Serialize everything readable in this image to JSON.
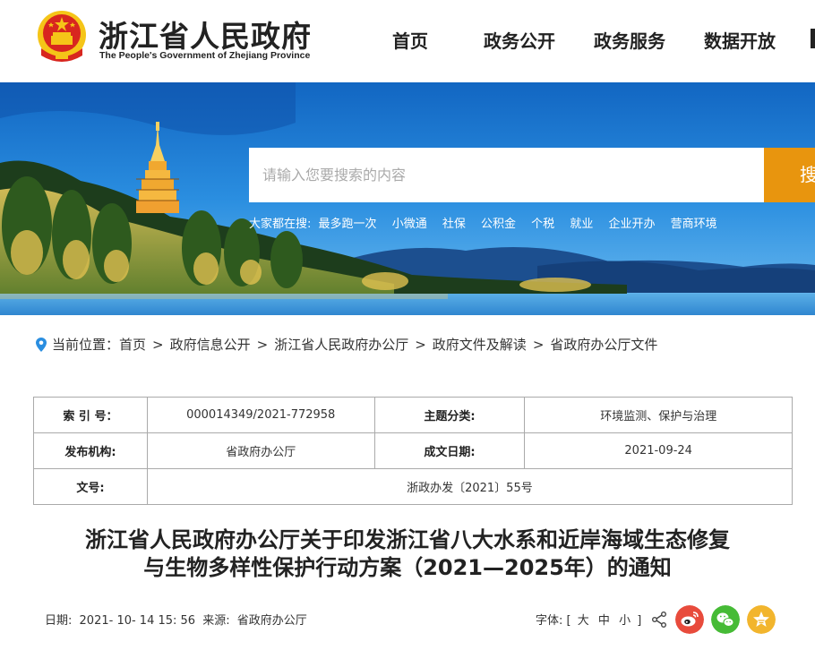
{
  "header": {
    "title": "浙江省人民政府",
    "subtitle": "The People's Government of Zhejiang Province",
    "nav": [
      "首页",
      "政务公开",
      "政务服务",
      "数据开放"
    ]
  },
  "search": {
    "placeholder": "请输入您要搜索的内容",
    "button_label": "搜索",
    "hot_label": "大家都在搜:",
    "hot_terms": [
      "最多跑一次",
      "小微通",
      "社保",
      "公积金",
      "个税",
      "就业",
      "企业开办",
      "营商环境"
    ]
  },
  "breadcrumb": {
    "label": "当前位置：",
    "items": [
      "首页",
      "政府信息公开",
      "浙江省人民政府办公厅",
      "政府文件及解读",
      "省政府办公厅文件"
    ],
    "separator": ">"
  },
  "info": {
    "index_label": "索 引 号：",
    "index_value": "000014349/2021-772958",
    "topic_label": "主题分类:",
    "topic_value": "环境监测、保护与治理",
    "issuer_label": "发布机构:",
    "issuer_value": "省政府办公厅",
    "date_label": "成文日期:",
    "date_value": "2021-09-24",
    "docno_label": "文号:",
    "docno_value": "浙政办发〔2021〕55号"
  },
  "document": {
    "title_line1": "浙江省人民政府办公厅关于印发浙江省八大水系和近岸海域生态修复",
    "title_line2": "与生物多样性保护行动方案（2021—2025年）的通知"
  },
  "meta": {
    "date_label": "日期:",
    "date_value": "2021- 10- 14 15: 56",
    "source_label": "来源:",
    "source_value": "省政府办公厅",
    "font_label": "字体:",
    "font_open": "[",
    "font_large": "大",
    "font_medium": "中",
    "font_small": "小",
    "font_close": "]"
  },
  "colors": {
    "accent": "#e8950e",
    "weibo": "#e84b3c",
    "wechat": "#46bb36",
    "favorite": "#f2b52d",
    "banner_sky": "#1a80d8"
  },
  "icons": [
    "national-emblem-icon",
    "location-pin-icon",
    "share-icon",
    "weibo-icon",
    "wechat-icon",
    "favorite-icon"
  ]
}
